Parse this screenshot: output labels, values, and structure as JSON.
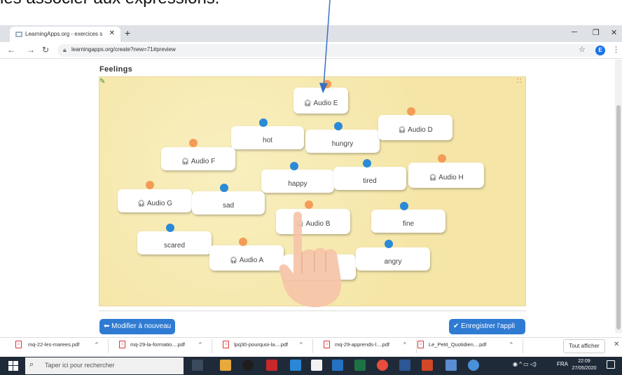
{
  "caption": "les associer aux expressions.",
  "browser": {
    "tab_title": "LearningApps.org - exercices sco",
    "tab_close": "✕",
    "new_tab": "+",
    "url": "learningapps.org/create?new=71#preview",
    "profile_initial": "E"
  },
  "app": {
    "title": "Feelings",
    "cards": [
      {
        "label": "Audio E",
        "audio": true,
        "dot": "orange"
      },
      {
        "label": "hot",
        "audio": false,
        "dot": "blue"
      },
      {
        "label": "hungry",
        "audio": false,
        "dot": "blue"
      },
      {
        "label": "Audio D",
        "audio": true,
        "dot": "orange"
      },
      {
        "label": "Audio F",
        "audio": true,
        "dot": "orange"
      },
      {
        "label": "happy",
        "audio": false,
        "dot": "blue"
      },
      {
        "label": "tired",
        "audio": false,
        "dot": "blue"
      },
      {
        "label": "Audio H",
        "audio": true,
        "dot": "orange"
      },
      {
        "label": "Audio G",
        "audio": true,
        "dot": "orange"
      },
      {
        "label": "sad",
        "audio": false,
        "dot": "blue"
      },
      {
        "label": "Audio B",
        "audio": true,
        "dot": "orange"
      },
      {
        "label": "fine",
        "audio": false,
        "dot": "blue"
      },
      {
        "label": "scared",
        "audio": false,
        "dot": "blue"
      },
      {
        "label": "Audio A",
        "audio": true,
        "dot": "orange"
      },
      {
        "label": "",
        "audio": false,
        "dot": "none"
      },
      {
        "label": "angry",
        "audio": false,
        "dot": "blue"
      }
    ],
    "modify_button": "Modifier à nouveau",
    "save_button": "Enregistrer l'appli"
  },
  "downloads": {
    "items": [
      "mq-22-les-marees.pdf",
      "mq-29-la-formatio....pdf",
      "lpq30-pourquoi-la....pdf",
      "mq-29-apprends-l....pdf",
      "Le_Petit_Quotidien....pdf"
    ],
    "show_all": "Tout afficher"
  },
  "taskbar": {
    "search_placeholder": "Taper ici pour rechercher",
    "lang": "FRA",
    "time": "22:09",
    "date": "27/05/2020"
  },
  "colors": {
    "board": "#f7eab1",
    "audio_dot": "#f39c57",
    "word_dot": "#2a8ad8",
    "button": "#2f7bd3"
  }
}
